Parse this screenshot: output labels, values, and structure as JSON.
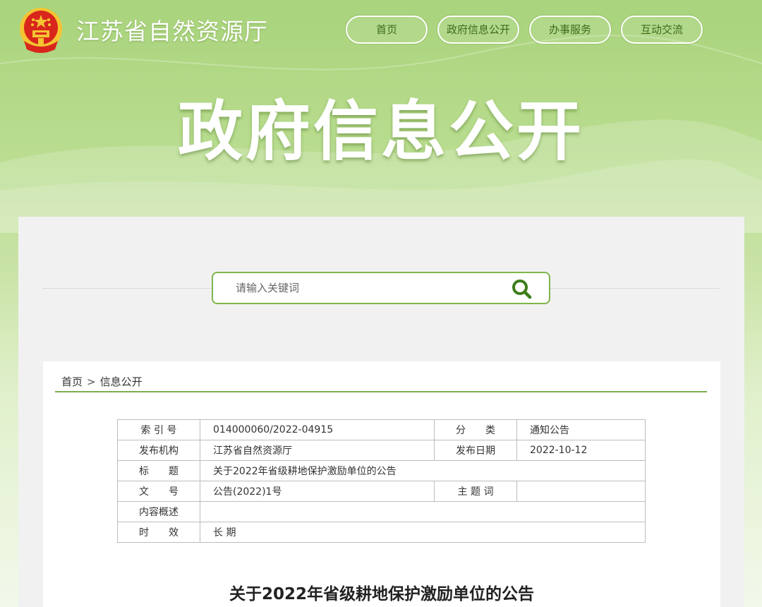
{
  "header": {
    "site_title": "江苏省自然资源厅",
    "nav": [
      {
        "label": "首页"
      },
      {
        "label": "政府信息公开"
      },
      {
        "label": "办事服务"
      },
      {
        "label": "互动交流"
      }
    ]
  },
  "banner": {
    "title": "政府信息公开"
  },
  "search": {
    "placeholder": "请输入关键词"
  },
  "breadcrumb": {
    "home": "首页",
    "separator": ">",
    "current": "信息公开"
  },
  "meta_table": {
    "index_label": "索 引 号",
    "index_value": "014000060/2022-04915",
    "category_label": "分　　类",
    "category_value": "通知公告",
    "publisher_label": "发布机构",
    "publisher_value": "江苏省自然资源厅",
    "date_label": "发布日期",
    "date_value": "2022-10-12",
    "title_label": "标　　题",
    "title_value": "关于2022年省级耕地保护激励单位的公告",
    "docno_label": "文　　号",
    "docno_value": "公告(2022)1号",
    "keywords_label": "主 题 词",
    "keywords_value": "",
    "summary_label": "内容概述",
    "summary_value": "",
    "validity_label": "时　　效",
    "validity_value": "长 期"
  },
  "document": {
    "heading": "关于2022年省级耕地保护激励单位的公告"
  },
  "colors": {
    "accent_green": "#7fb54a",
    "rule_green": "#7fae52",
    "emblem_red": "#d8261c",
    "emblem_gold": "#f4c431"
  },
  "icons": {
    "search": "search-icon",
    "emblem": "national-emblem-icon"
  }
}
